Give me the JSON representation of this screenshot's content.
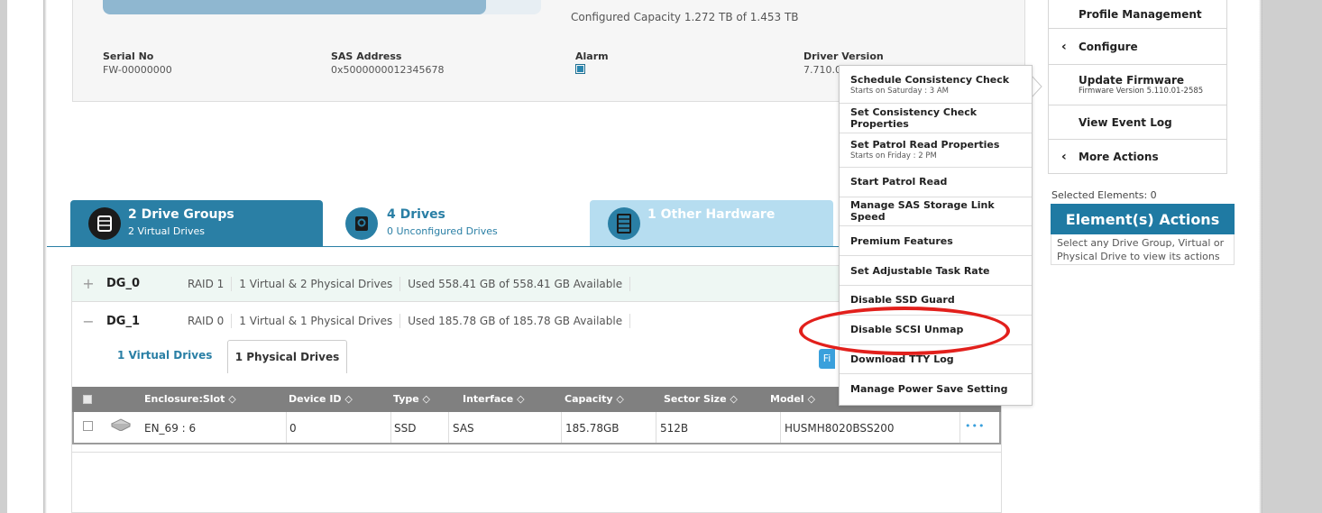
{
  "info": {
    "capacity_fraction": 0.875,
    "configured_capacity": "Configured Capacity 1.272 TB of 1.453 TB",
    "serial_label": "Serial No",
    "serial_value": "FW-00000000",
    "sas_label": "SAS Address",
    "sas_value": "0x5000000012345678",
    "alarm_label": "Alarm",
    "driver_label": "Driver Version",
    "driver_value": "7.710.0"
  },
  "right_panel": {
    "profile_mgmt": "Profile Management",
    "configure": "Configure",
    "update_fw": "Update Firmware",
    "update_fw_sub": "Firmware Version 5.110.01-2585",
    "view_event_log": "View Event Log",
    "more_actions": "More Actions",
    "selected_elements": "Selected Elements: 0",
    "element_actions": "Element(s) Actions",
    "element_desc": "Select any Drive Group, Virtual or Physical Drive to view its actions"
  },
  "summary_tabs": {
    "dg_title": "2 Drive Groups",
    "dg_sub": "2 Virtual Drives",
    "drv_title": "4 Drives",
    "drv_sub": "0 Unconfigured Drives",
    "oth_title": "1 Other Hardware"
  },
  "drive_groups": [
    {
      "sign": "+",
      "name": "DG_0",
      "raid": "RAID 1",
      "drives": "1 Virtual & 2 Physical Drives",
      "used": "Used 558.41 GB of 558.41 GB Available"
    },
    {
      "sign": "−",
      "name": "DG_1",
      "raid": "RAID 0",
      "drives": "1 Virtual & 1 Physical Drives",
      "used": "Used 185.78 GB of 185.78 GB Available"
    }
  ],
  "subtabs": {
    "virtual": "1 Virtual Drives",
    "physical": "1 Physical Drives",
    "filter_fragment": "Fi"
  },
  "pd_table": {
    "headers": [
      "Enclosure:Slot ◇",
      "Device ID ◇",
      "Type ◇",
      "Interface ◇",
      "Capacity ◇",
      "Sector Size ◇",
      "Model ◇"
    ],
    "row": {
      "slot": "EN_69 : 6",
      "device_id": "0",
      "type": "SSD",
      "interface": "SAS",
      "capacity": "185.78GB",
      "sector": "512B",
      "model": "HUSMH8020BSS200",
      "more": "•••"
    }
  },
  "context_menu": [
    {
      "label": "Schedule Consistency Check",
      "sub": "Starts on Saturday : 3 AM"
    },
    {
      "label": "Set Consistency Check Properties",
      "sub": ""
    },
    {
      "label": "Set Patrol Read Properties",
      "sub": "Starts on Friday : 2 PM"
    },
    {
      "label": "Start Patrol Read",
      "sub": ""
    },
    {
      "label": "Manage SAS Storage Link Speed",
      "sub": ""
    },
    {
      "label": "Premium Features",
      "sub": ""
    },
    {
      "label": "Set Adjustable Task Rate",
      "sub": ""
    },
    {
      "label": "Disable SSD Guard",
      "sub": ""
    },
    {
      "label": "Disable SCSI Unmap",
      "sub": ""
    },
    {
      "label": "Download TTY Log",
      "sub": ""
    },
    {
      "label": "Manage Power Save Setting",
      "sub": ""
    }
  ],
  "colors": {
    "accent": "#2a7fa5",
    "highlight_ring": "#e2201c",
    "other_hw_tab": "#b6ddf0"
  }
}
